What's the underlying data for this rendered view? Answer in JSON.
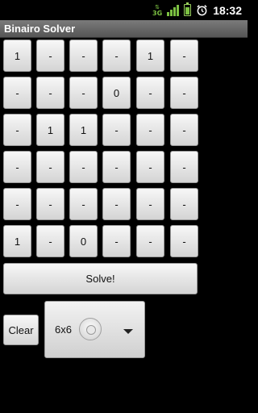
{
  "status_bar": {
    "network": "3G",
    "time": "18:32"
  },
  "app": {
    "title": "Binairo Solver"
  },
  "grid": [
    [
      "1",
      "-",
      "-",
      "-",
      "1",
      "-"
    ],
    [
      "-",
      "-",
      "-",
      "0",
      "-",
      "-"
    ],
    [
      "-",
      "1",
      "1",
      "-",
      "-",
      "-"
    ],
    [
      "-",
      "-",
      "-",
      "-",
      "-",
      "-"
    ],
    [
      "-",
      "-",
      "-",
      "-",
      "-",
      "-"
    ],
    [
      "1",
      "-",
      "0",
      "-",
      "-",
      "-"
    ]
  ],
  "actions": {
    "solve_label": "Solve!",
    "clear_label": "Clear"
  },
  "size_select": {
    "selected": "6x6"
  }
}
